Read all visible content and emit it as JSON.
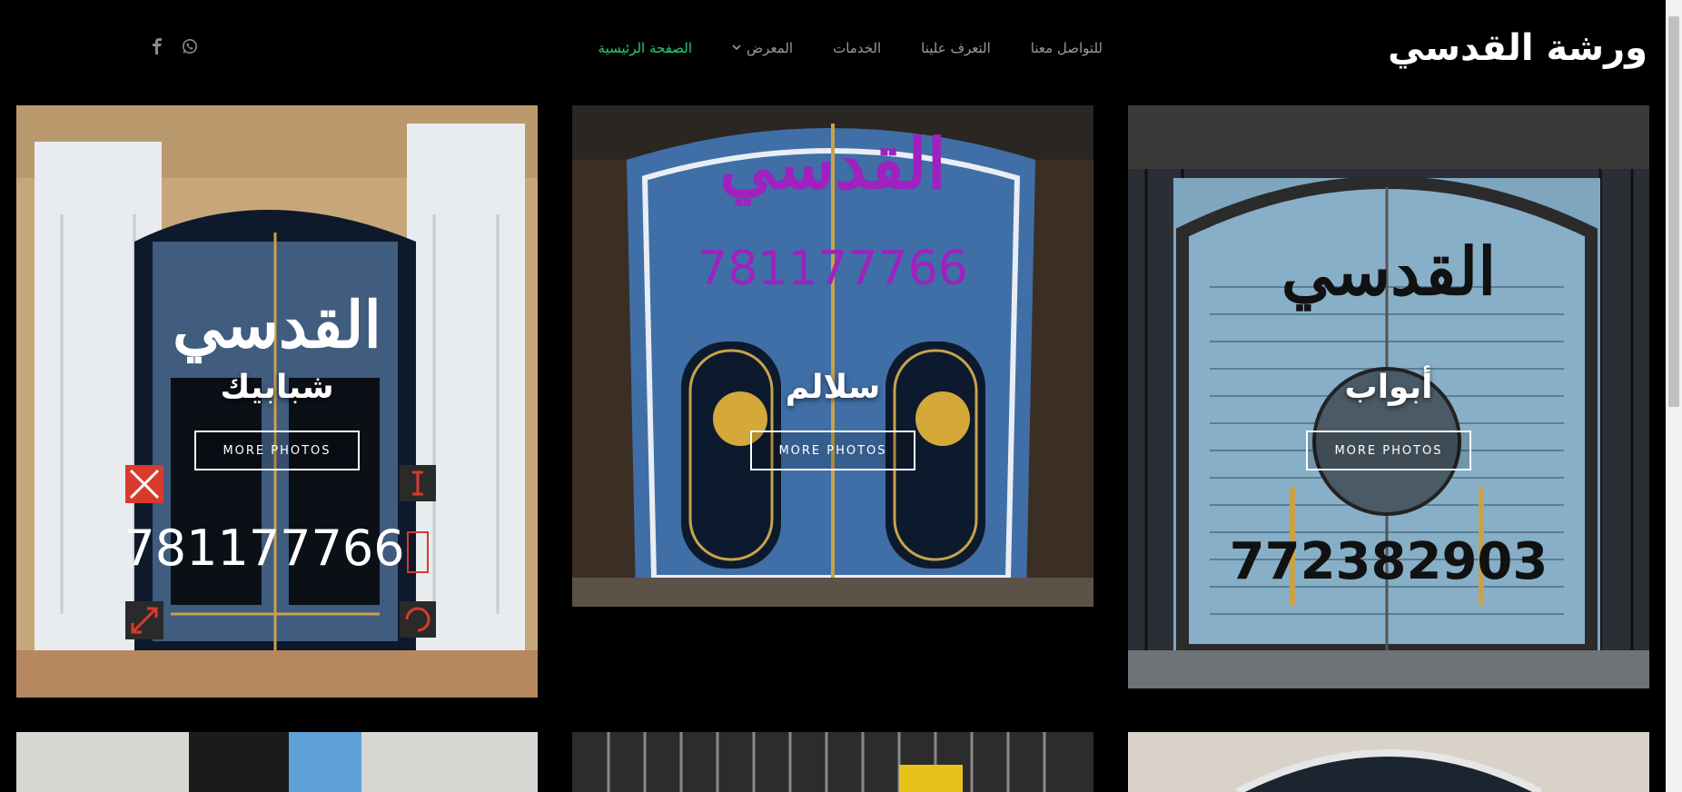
{
  "header": {
    "site_title": "ورشة القدسي",
    "nav": [
      {
        "label": "الصفحة الرئيسية",
        "active": true
      },
      {
        "label": "المعرض",
        "has_dropdown": true
      },
      {
        "label": "الخدمات"
      },
      {
        "label": "التعرف علينا"
      },
      {
        "label": "للتواصل معنا"
      }
    ],
    "social_icons": [
      "whatsapp-icon",
      "facebook-icon"
    ]
  },
  "gallery": [
    {
      "title": "أبواب",
      "button": "MORE PHOTOS",
      "brand": "القدسي",
      "phone": "772382903"
    },
    {
      "title": "سلالم",
      "button": "MORE PHOTOS",
      "brand": "القدسي",
      "phone": "781177766"
    },
    {
      "title": "شبابيك",
      "button": "MORE PHOTOS",
      "brand": "القدسي",
      "phone": "781177766"
    }
  ],
  "colors": {
    "background": "#000000",
    "nav_active": "#2ecc71",
    "nav_default": "#9a9a9a",
    "brand_purple": "#a020c0"
  }
}
